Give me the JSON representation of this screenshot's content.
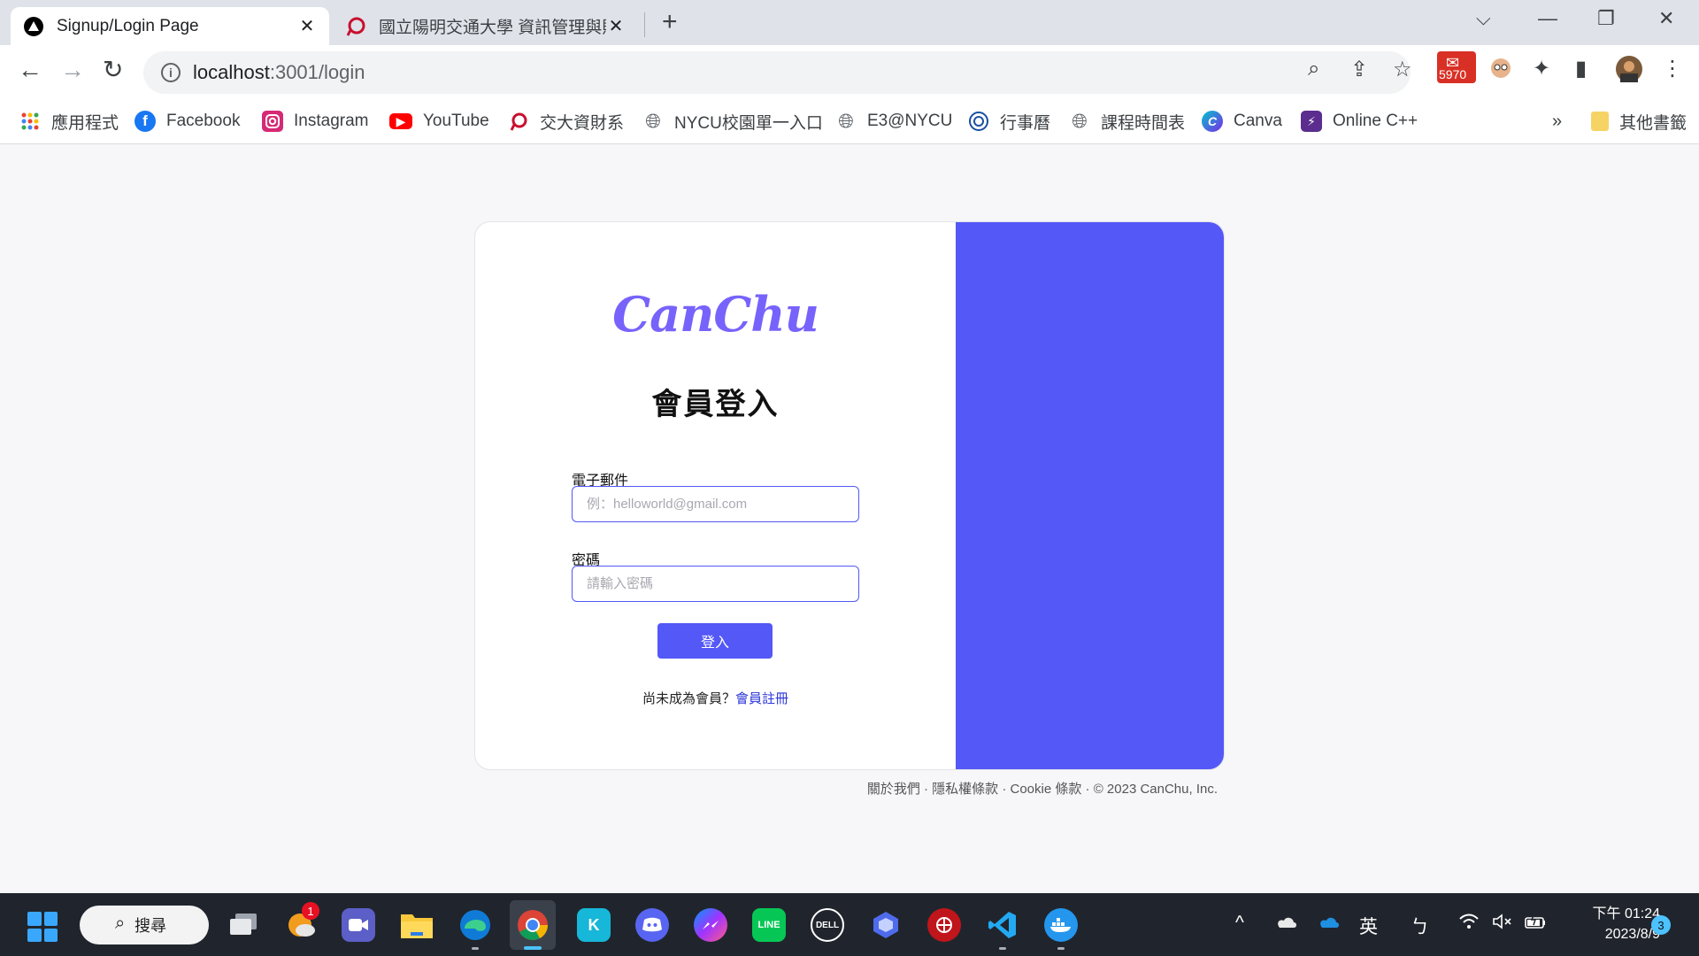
{
  "browser": {
    "tabs": [
      {
        "title": "Signup/Login Page",
        "close": "✕"
      },
      {
        "title": "國立陽明交通大學 資訊管理與財",
        "close": "✕"
      }
    ],
    "new_tab": "+",
    "window_controls": {
      "dropdown": "⌵",
      "minimize": "—",
      "restore": "❐",
      "close": "✕"
    },
    "nav": {
      "back": "←",
      "forward": "→",
      "reload": "↻"
    },
    "omnibox": {
      "info": "i",
      "host": "localhost",
      "path": ":3001/login"
    },
    "omnibox_icons": {
      "zoom": "⌕",
      "share": "⇪",
      "star": "☆"
    },
    "extensions": {
      "mail_count": "5970",
      "puzzle": "✦",
      "sidebar": "▮",
      "menu": "⋮"
    },
    "bookmarks": [
      {
        "label": "應用程式",
        "icon": "apps-grid-icon",
        "color": "#ea4335"
      },
      {
        "label": "Facebook",
        "icon": "facebook-icon",
        "color": "#1877f2"
      },
      {
        "label": "Instagram",
        "icon": "instagram-icon",
        "color": "#d62976"
      },
      {
        "label": "YouTube",
        "icon": "youtube-icon",
        "color": "#ff0000"
      },
      {
        "label": "交大資財系",
        "icon": "nycu-logo-icon",
        "color": "#c8102e"
      },
      {
        "label": "NYCU校園單一入口",
        "icon": "globe-icon",
        "color": "#5f6368"
      },
      {
        "label": "E3@NYCU",
        "icon": "globe-icon",
        "color": "#5f6368"
      },
      {
        "label": "行事曆",
        "icon": "nycu-seal-icon",
        "color": "#1a4fa0"
      },
      {
        "label": "課程時間表",
        "icon": "globe-icon",
        "color": "#5f6368"
      },
      {
        "label": "Canva",
        "icon": "canva-icon",
        "color": "#00c4cc"
      },
      {
        "label": "Online C++",
        "icon": "bolt-icon",
        "color": "#5b2d8e"
      }
    ],
    "bookmarks_overflow": "»",
    "other_bookmarks": "其他書籤"
  },
  "login": {
    "logo": "CanChu",
    "heading": "會員登入",
    "email_label": "電子郵件",
    "email_placeholder": "例：helloworld@gmail.com",
    "password_label": "密碼",
    "password_placeholder": "請輸入密碼",
    "submit_label": "登入",
    "signup_prompt": "尚未成為會員？",
    "signup_link": "會員註冊",
    "accent_color": "#5458f7"
  },
  "footer": "關於我們 · 隱私權條款 · Cookie 條款 · © 2023 CanChu, Inc.",
  "taskbar": {
    "search_label": "搜尋",
    "search_icon": "⌕",
    "weather_badge": "1",
    "apps": [
      "task-view",
      "weather",
      "teams",
      "file-explorer",
      "edge",
      "chrome",
      "kkbox",
      "discord",
      "messenger",
      "line",
      "dell",
      "copilot",
      "security",
      "vscode",
      "docker"
    ],
    "tray": {
      "chevron": "^",
      "ime": "英",
      "ime2": "ㄅ"
    },
    "clock_time": "下午 01:24",
    "clock_date": "2023/8/9",
    "notification_count": "3"
  }
}
